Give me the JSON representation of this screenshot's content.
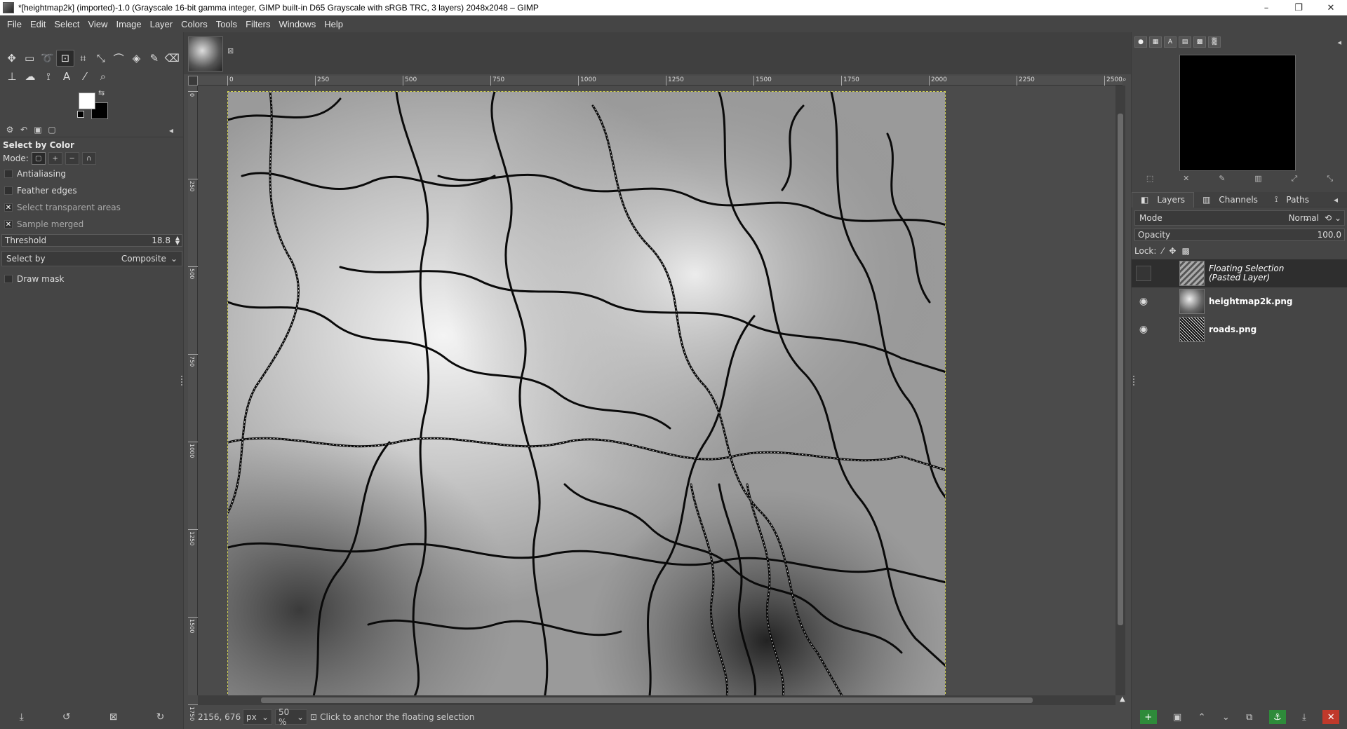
{
  "window": {
    "title": "*[heightmap2k] (imported)-1.0 (Grayscale 16-bit gamma integer, GIMP built-in D65 Grayscale with sRGB TRC, 3 layers) 2048x2048 – GIMP",
    "minimize": "–",
    "maximize": "❐",
    "close": "✕"
  },
  "menu": [
    "File",
    "Edit",
    "Select",
    "View",
    "Image",
    "Layer",
    "Colors",
    "Tools",
    "Filters",
    "Windows",
    "Help"
  ],
  "tool_options": {
    "title": "Select by Color",
    "mode_label": "Mode:",
    "antialiasing": "Antialiasing",
    "feather": "Feather edges",
    "select_transparent": "Select transparent areas",
    "sample_merged": "Sample merged",
    "threshold_label": "Threshold",
    "threshold_value": "18.8",
    "select_by_label": "Select by",
    "select_by_value": "Composite",
    "draw_mask": "Draw mask",
    "check_mark": "✕"
  },
  "ruler_h": [
    "0",
    "250",
    "500",
    "750",
    "1000",
    "1250",
    "1500",
    "1750",
    "2000",
    "2250",
    "2500"
  ],
  "ruler_v": [
    "0",
    "250",
    "500",
    "750",
    "1000",
    "1250",
    "1500",
    "1750"
  ],
  "status": {
    "coords": "2156, 676",
    "unit": "px",
    "zoom": "50 %",
    "message": "Click to anchor the floating selection"
  },
  "layers_panel": {
    "tabs": [
      "Layers",
      "Channels",
      "Paths"
    ],
    "mode_label": "Mode",
    "mode_value": "Normal",
    "opacity_label": "Opacity",
    "opacity_value": "100.0",
    "lock_label": "Lock:",
    "layers": [
      {
        "name_line1": "Floating Selection",
        "name_line2": "(Pasted Layer)"
      },
      {
        "name": "heightmap2k.png"
      },
      {
        "name": "roads.png"
      }
    ]
  },
  "colors": {
    "foreground": "#ffffff",
    "background": "#000000",
    "selection_border": "#cfcf50"
  }
}
